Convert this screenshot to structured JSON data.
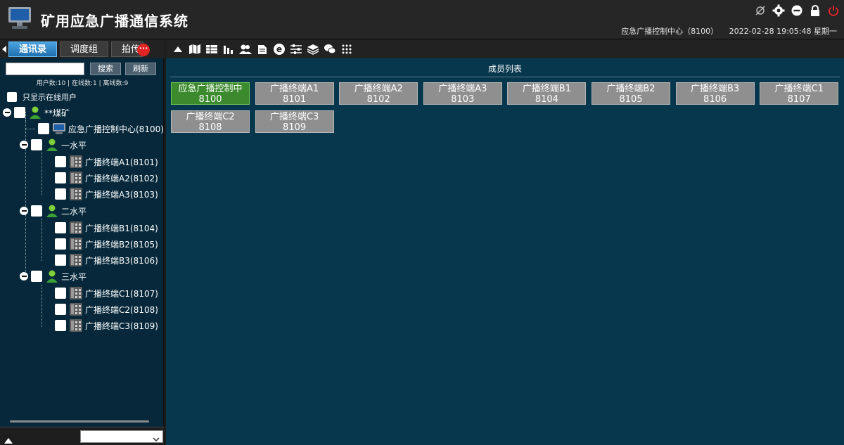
{
  "header": {
    "title": "矿用应急广播通信系统",
    "center_name": "应急广播控制中心（8100）",
    "datetime": "2022-02-28 19:05:48 星期一"
  },
  "left": {
    "tabs": [
      {
        "label": "通讯录"
      },
      {
        "label": "调度组"
      },
      {
        "label": "拍传"
      }
    ],
    "badge": "···",
    "search_btn": "搜索",
    "refresh_btn": "刷新",
    "counts": "用户数:10 | 在线数:1 | 离线数:9",
    "online_only": "只显示在线用户",
    "tree": {
      "root": "**煤矿",
      "center": "应急广播控制中心(8100)",
      "groups": [
        {
          "label": "一水平",
          "items": [
            "广播终端A1(8101)",
            "广播终端A2(8102)",
            "广播终端A3(8103)"
          ]
        },
        {
          "label": "二水平",
          "items": [
            "广播终端B1(8104)",
            "广播终端B2(8105)",
            "广播终端B3(8106)"
          ]
        },
        {
          "label": "三水平",
          "items": [
            "广播终端C1(8107)",
            "广播终端C2(8108)",
            "广播终端C3(8109)"
          ]
        }
      ]
    }
  },
  "right": {
    "title": "成员列表",
    "members": [
      {
        "name": "应急广播控制中",
        "id": "8100",
        "active": true
      },
      {
        "name": "广播终端A1",
        "id": "8101",
        "active": false
      },
      {
        "name": "广播终端A2",
        "id": "8102",
        "active": false
      },
      {
        "name": "广播终端A3",
        "id": "8103",
        "active": false
      },
      {
        "name": "广播终端B1",
        "id": "8104",
        "active": false
      },
      {
        "name": "广播终端B2",
        "id": "8105",
        "active": false
      },
      {
        "name": "广播终端B3",
        "id": "8106",
        "active": false
      },
      {
        "name": "广播终端C1",
        "id": "8107",
        "active": false
      },
      {
        "name": "广播终端C2",
        "id": "8108",
        "active": false
      },
      {
        "name": "广播终端C3",
        "id": "8109",
        "active": false
      }
    ]
  },
  "colors": {
    "accent_red": "#e02424",
    "member_active": "#3c8a2e",
    "member_idle": "#8f8f8f"
  }
}
